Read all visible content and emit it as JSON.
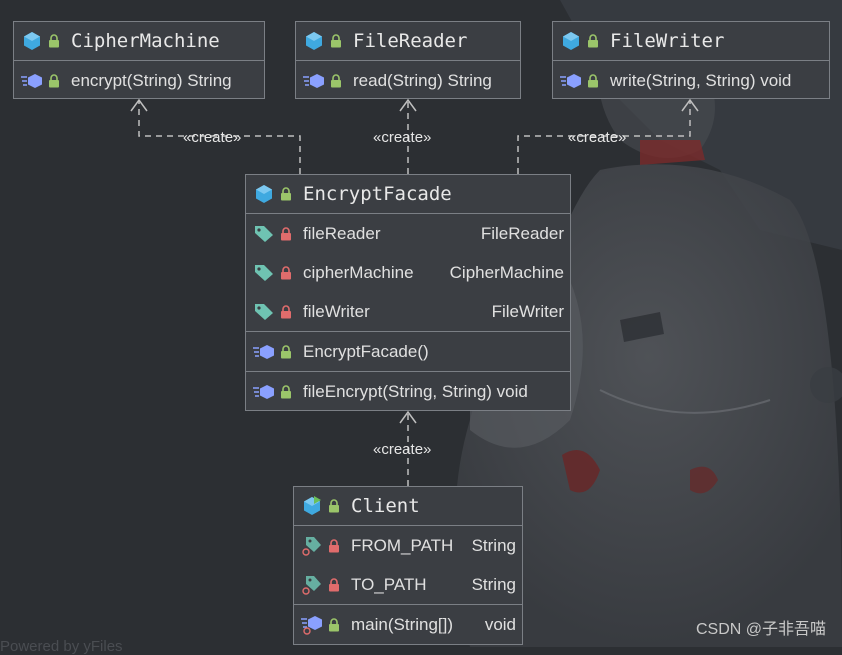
{
  "colors": {
    "background": "#2c2f33",
    "class_fill": "#3b3e43",
    "border": "#7b7f85",
    "class_icon": "#3fa9e0",
    "public_lock": "#9bc56a",
    "private_lock": "#e06c6c",
    "field_tag": "#6fc3b2",
    "method_icon": "#8aa0ff"
  },
  "classes": {
    "cipher_machine": {
      "name": "CipherMachine",
      "methods": [
        {
          "name": "encrypt(String) String",
          "type": "",
          "visibility": "public"
        }
      ]
    },
    "file_reader": {
      "name": "FileReader",
      "methods": [
        {
          "name": "read(String) String",
          "type": "",
          "visibility": "public"
        }
      ]
    },
    "file_writer": {
      "name": "FileWriter",
      "methods": [
        {
          "name": "write(String, String) void",
          "type": "",
          "visibility": "public"
        }
      ]
    },
    "encrypt_facade": {
      "name": "EncryptFacade",
      "fields": [
        {
          "name": "fileReader",
          "type": "FileReader",
          "visibility": "private"
        },
        {
          "name": "cipherMachine",
          "type": "CipherMachine",
          "visibility": "private"
        },
        {
          "name": "fileWriter",
          "type": "FileWriter",
          "visibility": "private"
        }
      ],
      "constructors": [
        {
          "name": "EncryptFacade()",
          "type": "",
          "visibility": "public"
        }
      ],
      "methods": [
        {
          "name": "fileEncrypt(String, String) void",
          "type": "",
          "visibility": "public"
        }
      ]
    },
    "client": {
      "name": "Client",
      "fields": [
        {
          "name": "FROM_PATH",
          "type": "String",
          "visibility": "private",
          "static": true
        },
        {
          "name": "TO_PATH",
          "type": "String",
          "visibility": "private",
          "static": true
        }
      ],
      "methods": [
        {
          "name": "main(String[])",
          "type": "void",
          "visibility": "public",
          "static": true
        }
      ]
    }
  },
  "edges": {
    "facade_to_cipher": "«create»",
    "facade_to_reader": "«create»",
    "facade_to_writer": "«create»",
    "client_to_facade": "«create»"
  },
  "footer": {
    "watermark": "CSDN @子非吾喵",
    "powered_by": "Powered by yFiles"
  }
}
